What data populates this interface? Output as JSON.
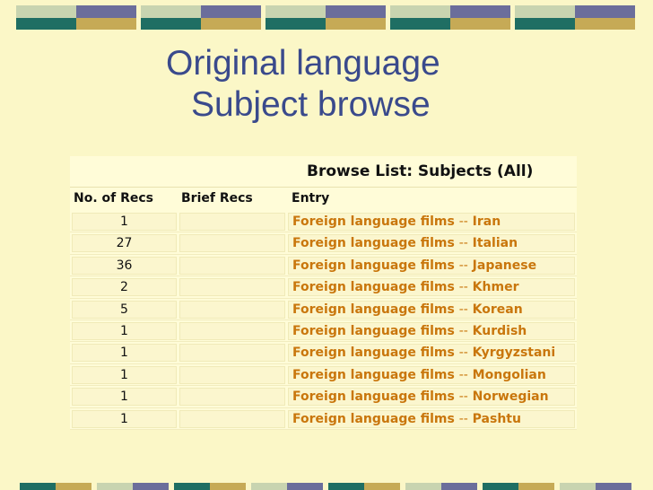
{
  "slide": {
    "title_line1": "Original language",
    "title_line2": "Subject browse"
  },
  "browse_list": {
    "header": "Browse List: Subjects (All)",
    "columns": [
      "No. of Recs",
      "Brief Recs",
      "Entry"
    ],
    "rows": [
      {
        "count": "1",
        "brief": "",
        "subject": "Foreign language films",
        "sep": "--",
        "sub": "Iran"
      },
      {
        "count": "27",
        "brief": "",
        "subject": "Foreign language films",
        "sep": "--",
        "sub": "Italian"
      },
      {
        "count": "36",
        "brief": "",
        "subject": "Foreign language films",
        "sep": "--",
        "sub": "Japanese"
      },
      {
        "count": "2",
        "brief": "",
        "subject": "Foreign language films",
        "sep": "--",
        "sub": "Khmer"
      },
      {
        "count": "5",
        "brief": "",
        "subject": "Foreign language films",
        "sep": "--",
        "sub": "Korean"
      },
      {
        "count": "1",
        "brief": "",
        "subject": "Foreign language films",
        "sep": "--",
        "sub": "Kurdish"
      },
      {
        "count": "1",
        "brief": "",
        "subject": "Foreign language films",
        "sep": "--",
        "sub": "Kyrgyzstani"
      },
      {
        "count": "1",
        "brief": "",
        "subject": "Foreign language films",
        "sep": "--",
        "sub": "Mongolian"
      },
      {
        "count": "1",
        "brief": "",
        "subject": "Foreign language films",
        "sep": "--",
        "sub": "Norwegian"
      },
      {
        "count": "1",
        "brief": "",
        "subject": "Foreign language films",
        "sep": "--",
        "sub": "Pashtu"
      }
    ]
  },
  "colors": {
    "background": "#FBF7C7",
    "title": "#3A4A8C",
    "link": "#C9760C",
    "tile_sage": "#C8D4B0",
    "tile_slate": "#6B6E9B",
    "tile_teal": "#1F6E63",
    "tile_gold": "#C6AA56"
  }
}
